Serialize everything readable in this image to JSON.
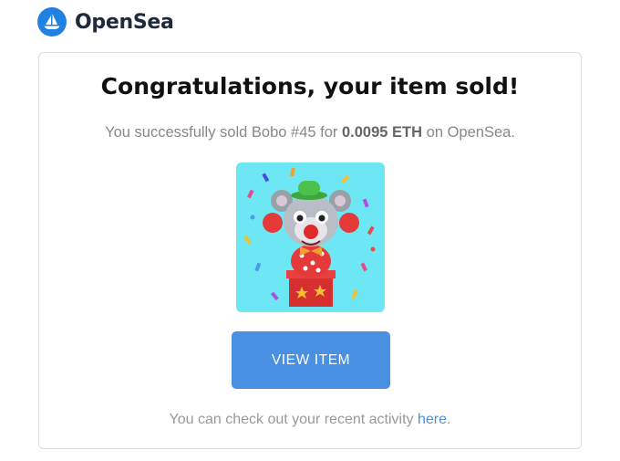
{
  "brand": {
    "name": "OpenSea",
    "logo_icon": "opensea-boat-icon",
    "color": "#2081e2"
  },
  "email": {
    "title": "Congratulations, your item sold!",
    "sold_prefix": "You successfully sold Bobo #45 for",
    "price": "0.0095 ETH",
    "sold_suffix": "on OpenSea.",
    "image_icon": "clown-koala-nft-image",
    "button_label": "VIEW ITEM",
    "button_color": "#4a90e2",
    "footer_prefix": "You can check out your recent activity",
    "footer_link": "here",
    "footer_suffix": "."
  }
}
